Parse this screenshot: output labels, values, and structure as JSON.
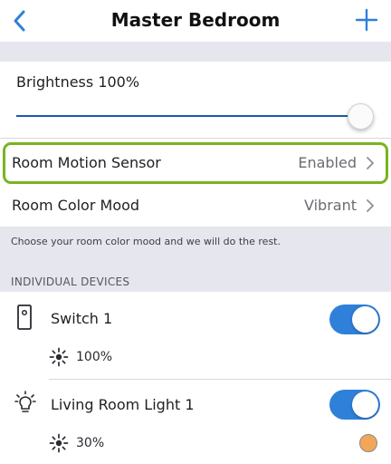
{
  "navbar": {
    "title": "Master Bedroom",
    "back_icon": "chevron-left-icon",
    "add_icon": "plus-icon",
    "accent_color": "#2f80d9"
  },
  "brightness": {
    "label": "Brightness 100%",
    "value_percent": 100
  },
  "settings": [
    {
      "label": "Room Motion Sensor",
      "value": "Enabled",
      "highlighted": true,
      "highlight_color": "#79b41f"
    },
    {
      "label": "Room Color Mood",
      "value": "Vibrant"
    }
  ],
  "note": "Choose your room color mood and we will do the rest.",
  "devices_section": {
    "header": "INDIVIDUAL DEVICES",
    "devices": [
      {
        "name": "Switch 1",
        "icon": "wall-switch-icon",
        "on": true,
        "level": "100%",
        "level_icon": "brightness-icon"
      },
      {
        "name": "Living Room Light 1",
        "icon": "light-bulb-icon",
        "on": true,
        "level": "30%",
        "level_icon": "brightness-icon",
        "color": "#f2a65a"
      }
    ]
  }
}
